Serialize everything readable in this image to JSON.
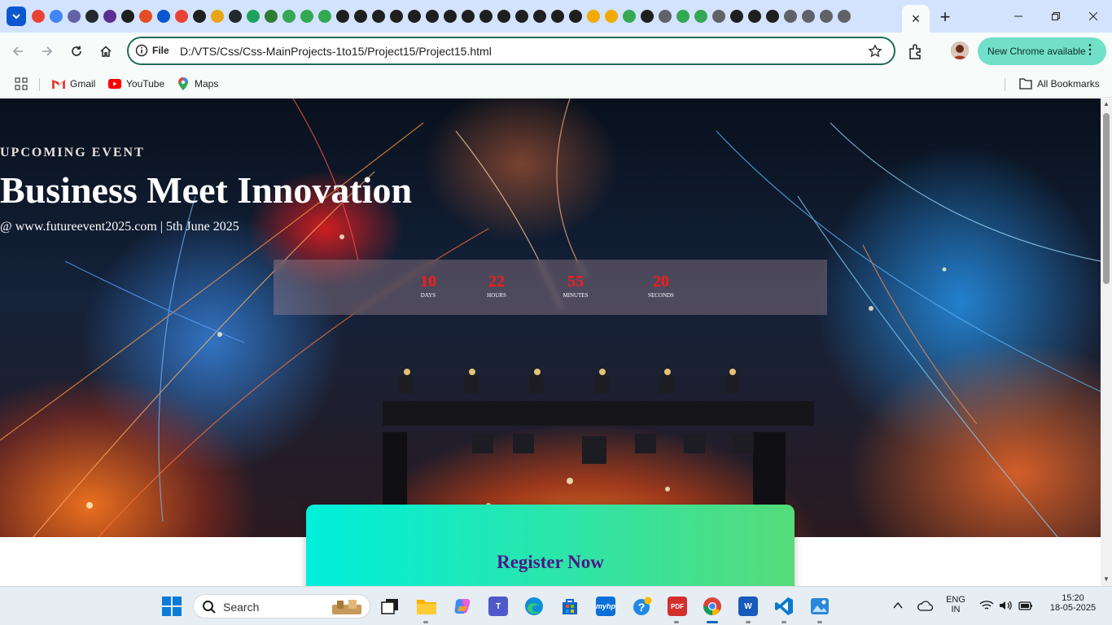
{
  "window": {
    "active_tab_close": "×",
    "new_tab": "+"
  },
  "toolbar": {
    "omnibox_scheme": "File",
    "url": "D:/VTS/Css/Css-MainProjects-1to15/Project15/Project15.html",
    "update_label": "New Chrome available"
  },
  "bookmarks": {
    "items": [
      {
        "label": "Gmail",
        "icon": "gmail-icon"
      },
      {
        "label": "YouTube",
        "icon": "youtube-icon"
      },
      {
        "label": "Maps",
        "icon": "maps-icon"
      }
    ],
    "all_bookmarks": "All Bookmarks"
  },
  "page": {
    "eyebrow": "UPCOMING EVENT",
    "title": "Business Meet Innovation",
    "subtitle": "@ www.futureevent2025.com | 5th June 2025",
    "countdown": [
      {
        "value": "10",
        "label": "Days"
      },
      {
        "value": "22",
        "label": "Hours"
      },
      {
        "value": "55",
        "label": "Minutes"
      },
      {
        "value": "20",
        "label": "Seconds"
      }
    ],
    "register_heading": "Register Now"
  },
  "taskbar": {
    "search_placeholder": "Search",
    "language_top": "ENG",
    "language_bottom": "IN",
    "time": "15:20",
    "date": "18-05-2025"
  },
  "colors": {
    "accent": "#0b57d0",
    "omnibox_border": "#1f6b58",
    "countdown_number": "#ff1a1a",
    "register_gradient_start": "#00f0dc",
    "register_gradient_end": "#55db7a",
    "register_text": "#4a1a8a"
  }
}
